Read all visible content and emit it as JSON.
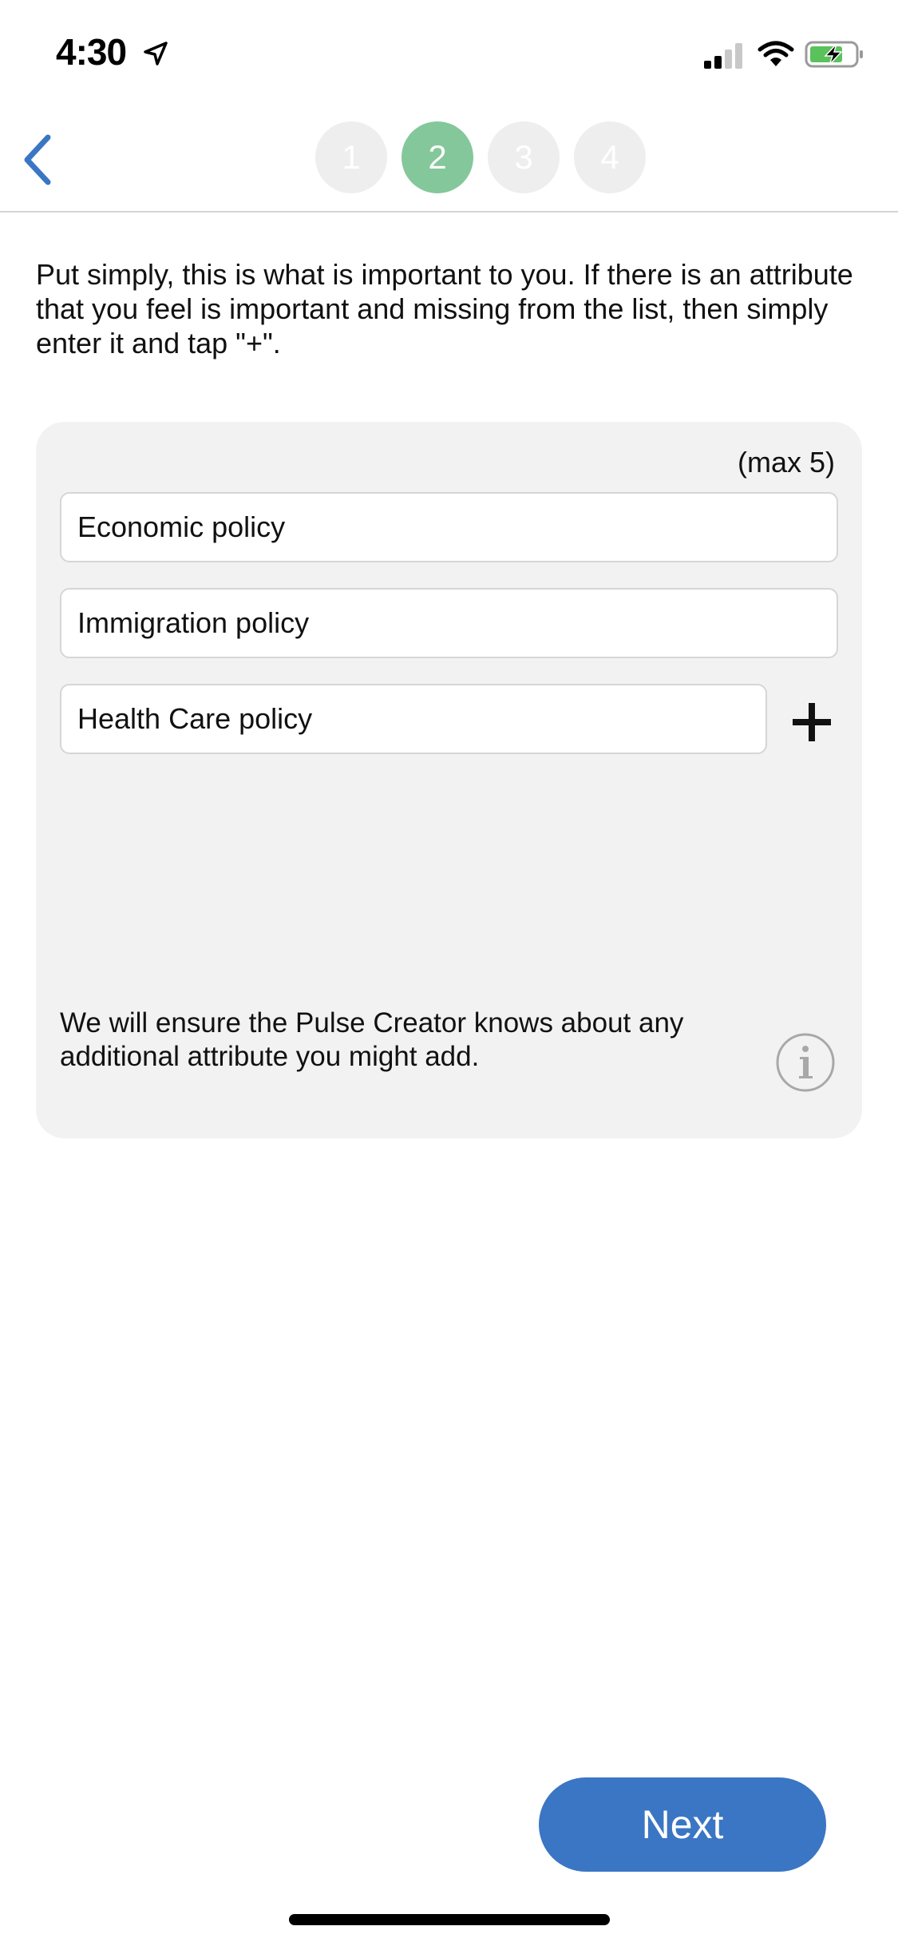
{
  "status_bar": {
    "time": "4:30",
    "icons": [
      "location-arrow-icon",
      "cellular-signal-icon",
      "wifi-icon",
      "battery-charging-icon"
    ]
  },
  "header": {
    "back_icon": "chevron-left-icon",
    "steps": [
      {
        "label": "1",
        "active": false
      },
      {
        "label": "2",
        "active": true
      },
      {
        "label": "3",
        "active": false
      },
      {
        "label": "4",
        "active": false
      }
    ],
    "current_step": 2
  },
  "intro": {
    "text": "Put simply, this is what is important to you. If there is an attribute that you feel is important and missing from the list, then simply enter it and tap \"+\"."
  },
  "attributes": {
    "max_label": "(max 5)",
    "items": [
      {
        "value": "Economic policy"
      },
      {
        "value": "Immigration policy"
      },
      {
        "value": "Health Care policy"
      }
    ],
    "add_icon": "plus-icon",
    "note": "We will ensure the Pulse Creator knows about any additional attribute you might add.",
    "info_icon": "info-icon"
  },
  "actions": {
    "next_label": "Next"
  },
  "colors": {
    "accent_blue": "#3a76c4",
    "active_step_green": "#84c79b",
    "inactive_step": "#eeeeee",
    "panel_bg": "#f2f2f2"
  }
}
